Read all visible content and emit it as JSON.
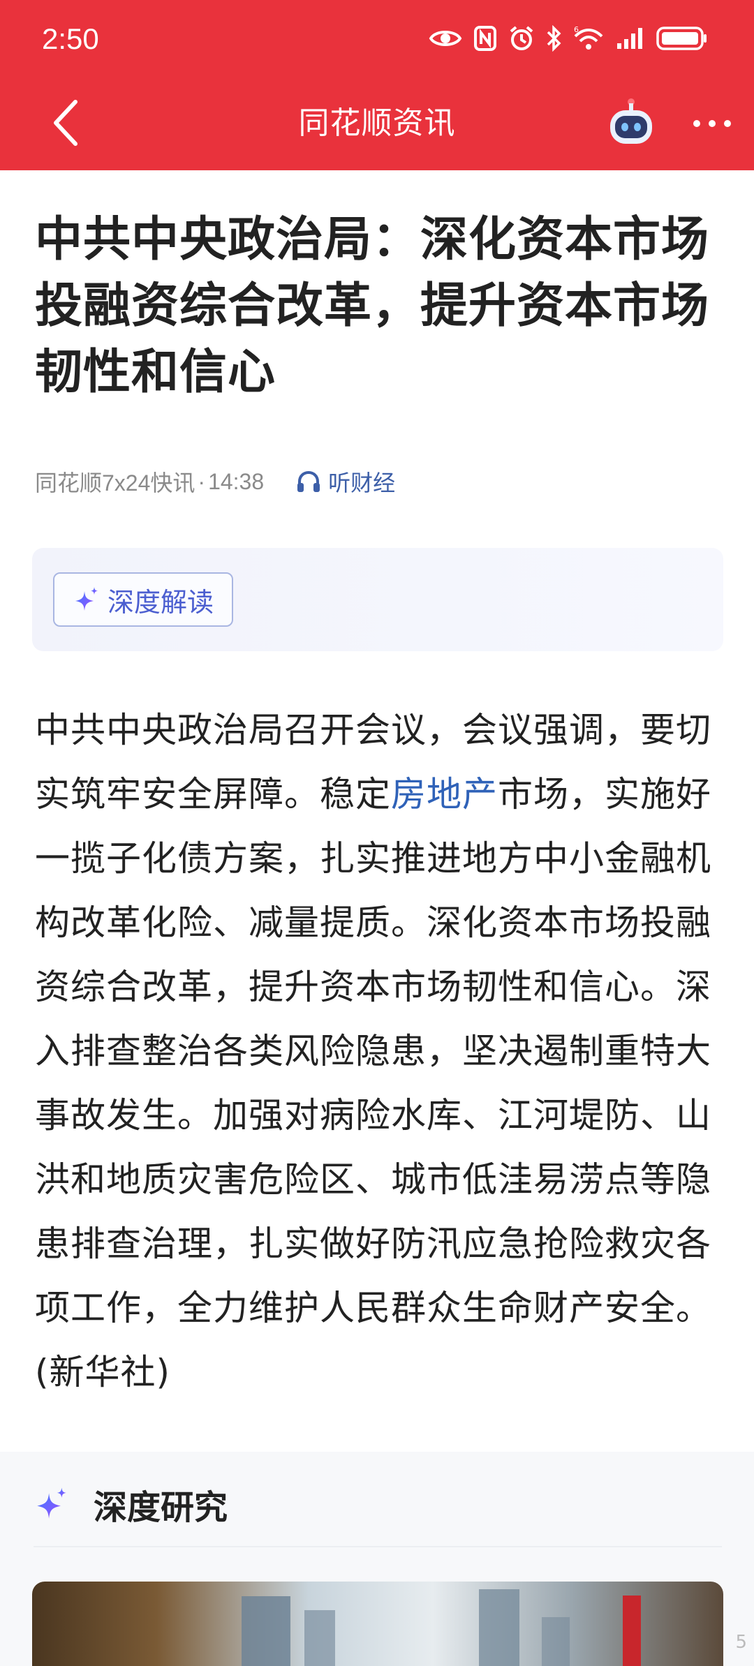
{
  "status_bar": {
    "time": "2:50",
    "icons": [
      "eye-icon",
      "nfc-icon",
      "alarm-icon",
      "bluetooth-icon",
      "wifi-6-icon",
      "signal-icon",
      "battery-icon"
    ]
  },
  "nav": {
    "title": "同花顺资讯",
    "back_icon": "chevron-left-icon",
    "robot_icon": "robot-assistant-icon",
    "more_icon": "more-dots-icon"
  },
  "colors": {
    "header_red": "#e9323c",
    "link_blue": "#2f62b8",
    "ai_purple": "#4c5fd0"
  },
  "article": {
    "headline": "中共中央政治局：深化资本市场投融资综合改革，提升资本市场韧性和信心",
    "source": "同花顺7x24快讯",
    "separator": "·",
    "time": "14:38",
    "listen_label": "听财经",
    "ai_button_label": "深度解读",
    "body_before_link": "中共中央政治局召开会议，会议强调，要切实筑牢安全屏障。稳定",
    "body_link": "房地产",
    "body_after_link": "市场，实施好一揽子化债方案，扎实推进地方中小金融机构改革化险、减量提质。深化资本市场投融资综合改革，提升资本市场韧性和信心。深入排查整治各类风险隐患，坚决遏制重特大事故发生。加强对病险水库、江河堤防、山洪和地质灾害危险区、城市低洼易涝点等隐患排查治理，扎实做好防汛应急抢险救灾各项工作，全力维护人民群众生命财产安全。(新华社)"
  },
  "deep_research": {
    "title": "深度研究",
    "icon": "sparkle-icon"
  },
  "corner_mark": "5"
}
